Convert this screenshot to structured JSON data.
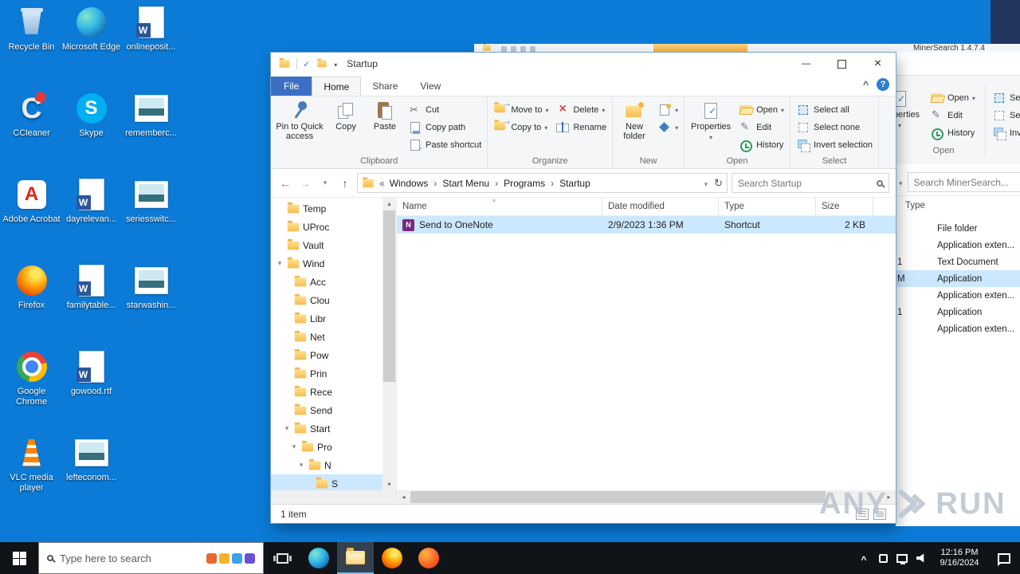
{
  "desktop": {
    "icons": [
      {
        "label": "Recycle Bin",
        "kind": "recycle"
      },
      {
        "label": "CCleaner",
        "kind": "ccleaner"
      },
      {
        "label": "Adobe Acrobat",
        "kind": "acrobat"
      },
      {
        "label": "Firefox",
        "kind": "firefox"
      },
      {
        "label": "Google Chrome",
        "kind": "chrome"
      },
      {
        "label": "VLC media player",
        "kind": "vlc"
      },
      {
        "label": "Microsoft Edge",
        "kind": "edge"
      },
      {
        "label": "Skype",
        "kind": "skype"
      },
      {
        "label": "dayrelevan...",
        "kind": "word"
      },
      {
        "label": "familytable...",
        "kind": "word"
      },
      {
        "label": "gowood.rtf",
        "kind": "word"
      },
      {
        "label": "lefteconom...",
        "kind": "image"
      },
      {
        "label": "onlineposit...",
        "kind": "word"
      },
      {
        "label": "rememberc...",
        "kind": "image"
      },
      {
        "label": "seriesswitc...",
        "kind": "image"
      },
      {
        "label": "starwashin...",
        "kind": "image"
      }
    ]
  },
  "explorer": {
    "title": "Startup",
    "tabs": {
      "file": "File",
      "items": [
        "Home",
        "Share",
        "View"
      ]
    },
    "ribbon": {
      "clipboard": {
        "label": "Clipboard",
        "pin": "Pin to Quick access",
        "copy": "Copy",
        "paste": "Paste",
        "cut": "Cut",
        "copy_path": "Copy path",
        "paste_shortcut": "Paste shortcut"
      },
      "organize": {
        "label": "Organize",
        "move_to": "Move to",
        "copy_to": "Copy to",
        "delete": "Delete",
        "rename": "Rename"
      },
      "new": {
        "label": "New",
        "new_folder": "New folder"
      },
      "open": {
        "label": "Open",
        "properties": "Properties",
        "open": "Open",
        "edit": "Edit",
        "history": "History"
      },
      "select": {
        "label": "Select",
        "select_all": "Select all",
        "select_none": "Select none",
        "invert": "Invert selection"
      }
    },
    "address": {
      "prefix": "«",
      "crumbs": [
        "Windows",
        "Start Menu",
        "Programs",
        "Startup"
      ]
    },
    "search_placeholder": "Search Startup",
    "tree": [
      {
        "label": "Temp",
        "level": 0,
        "exp": ""
      },
      {
        "label": "UProc",
        "level": 0,
        "exp": ""
      },
      {
        "label": "Vault",
        "level": 0,
        "exp": ""
      },
      {
        "label": "Wind",
        "level": 0,
        "exp": "open"
      },
      {
        "label": "Acc",
        "level": 1,
        "exp": ""
      },
      {
        "label": "Clou",
        "level": 1,
        "exp": ""
      },
      {
        "label": "Libr",
        "level": 1,
        "exp": ""
      },
      {
        "label": "Net",
        "level": 1,
        "exp": ""
      },
      {
        "label": "Pow",
        "level": 1,
        "exp": ""
      },
      {
        "label": "Prin",
        "level": 1,
        "exp": ""
      },
      {
        "label": "Rece",
        "level": 1,
        "exp": ""
      },
      {
        "label": "Send",
        "level": 1,
        "exp": ""
      },
      {
        "label": "Start",
        "level": 1,
        "exp": "open"
      },
      {
        "label": "Pro",
        "level": 2,
        "exp": "open"
      },
      {
        "label": "N",
        "level": 3,
        "exp": "open"
      },
      {
        "label": "S",
        "level": 4,
        "exp": "",
        "selected": true
      }
    ],
    "columns": [
      "Name",
      "Date modified",
      "Type",
      "Size"
    ],
    "files": [
      {
        "name": "Send to OneNote",
        "modified": "2/9/2023 1:36 PM",
        "type": "Shortcut",
        "size": "2 KB",
        "selected": true
      }
    ],
    "status": "1 item"
  },
  "bg_window": {
    "title": "MinerSearch 1.4.7.4",
    "ribbon": {
      "properties": "Properties",
      "open": "Open",
      "edit": "Edit",
      "history": "History",
      "select_all": "Select all",
      "select_none": "Select none",
      "invert": "Invert selection",
      "group_open": "Open"
    },
    "search_placeholder": "Search MinerSearch...",
    "type_column": "Type",
    "rows": [
      {
        "frag": "",
        "type": "File folder",
        "selected": false
      },
      {
        "frag": "",
        "type": "Application exten...",
        "selected": false
      },
      {
        "frag": "1",
        "type": "Text Document",
        "selected": false
      },
      {
        "frag": "M",
        "type": "Application",
        "selected": true
      },
      {
        "frag": "",
        "type": "Application exten...",
        "selected": false
      },
      {
        "frag": "1",
        "type": "Application",
        "selected": false
      },
      {
        "frag": "",
        "type": "Application exten...",
        "selected": false
      }
    ]
  },
  "taskbar": {
    "search_placeholder": "Type here to search",
    "clock": {
      "time": "12:16 PM",
      "date": "9/16/2024"
    }
  },
  "watermark": {
    "left": "ANY",
    "right": "RUN"
  },
  "icons": {
    "back": "left-arrow",
    "forward": "right-arrow",
    "up": "up-arrow",
    "refresh": "circular-arrow",
    "dropdown": "small-down-triangle",
    "collapse_ribbon": "caret-up",
    "help": "question-mark",
    "minimize": "dash",
    "maximize": "square",
    "close": "x",
    "breadcrumb_separator": "chevron-right",
    "overflow": "double-chevron-left",
    "search": "magnifier",
    "folder": "yellow-folder",
    "onenote": "purple-n-square",
    "sort_ascending": "caret-up"
  }
}
